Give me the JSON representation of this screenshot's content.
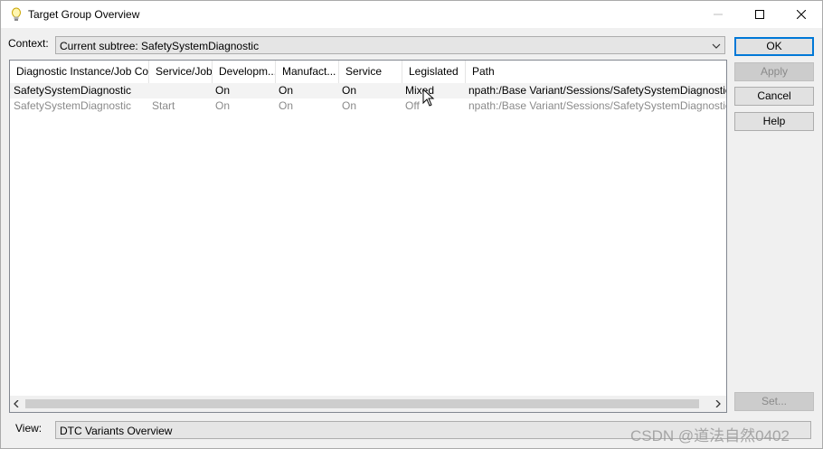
{
  "window": {
    "title": "Target Group Overview",
    "title_icon": "lightbulb-icon",
    "controls": [
      "minimize-icon",
      "maximize-icon",
      "close-icon"
    ]
  },
  "context": {
    "label": "Context:",
    "value": "Current subtree: SafetySystemDiagnostic"
  },
  "buttons": {
    "ok": "OK",
    "apply": "Apply",
    "cancel": "Cancel",
    "help": "Help",
    "set": "Set..."
  },
  "table": {
    "columns": [
      "Diagnostic Instance/Job Co...",
      "Service/Job",
      "Developm...",
      "Manufact...",
      "Service",
      "Legislated",
      "Path"
    ],
    "rows": [
      [
        "SafetySystemDiagnostic",
        "",
        "On",
        "On",
        "On",
        "Mixed",
        "npath:/Base Variant/Sessions/SafetySystemDiagnostic"
      ],
      [
        "SafetySystemDiagnostic",
        "Start",
        "On",
        "On",
        "On",
        "Off",
        "npath:/Base Variant/Sessions/SafetySystemDiagnostic/[SE"
      ]
    ]
  },
  "view": {
    "label": "View:",
    "value": "DTC Variants Overview"
  },
  "watermark": "CSDN @道法自然0402",
  "colors": {
    "window_bg": "#f0f0f0",
    "default_button_border": "#0078d7",
    "disabled_text": "#8a8a8a"
  }
}
